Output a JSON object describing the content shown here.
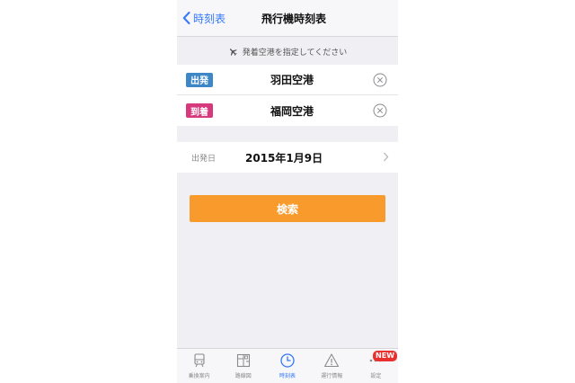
{
  "nav": {
    "back_label": "時刻表",
    "title": "飛行機時刻表"
  },
  "hint": {
    "text": "発着空港を指定してください",
    "icon": "airplane-icon"
  },
  "stations": {
    "departure": {
      "badge": "出発",
      "name": "羽田空港",
      "badge_color": "#3e87c7"
    },
    "arrival": {
      "badge": "到着",
      "name": "福岡空港",
      "badge_color": "#d63a7c"
    }
  },
  "date": {
    "label": "出発日",
    "value": "2015年1月9日"
  },
  "search": {
    "label": "検索",
    "color": "#f99a2c"
  },
  "tabs": [
    {
      "label": "乗換案内",
      "icon": "train-icon",
      "active": false
    },
    {
      "label": "路線図",
      "icon": "map-icon",
      "active": false
    },
    {
      "label": "時刻表",
      "icon": "clock-icon",
      "active": true
    },
    {
      "label": "運行情報",
      "icon": "warning-icon",
      "active": false
    },
    {
      "label": "設定",
      "icon": "more-icon",
      "active": false,
      "badge": "NEW"
    }
  ],
  "colors": {
    "accent": "#3478f6",
    "new_badge": "#e8312f"
  }
}
